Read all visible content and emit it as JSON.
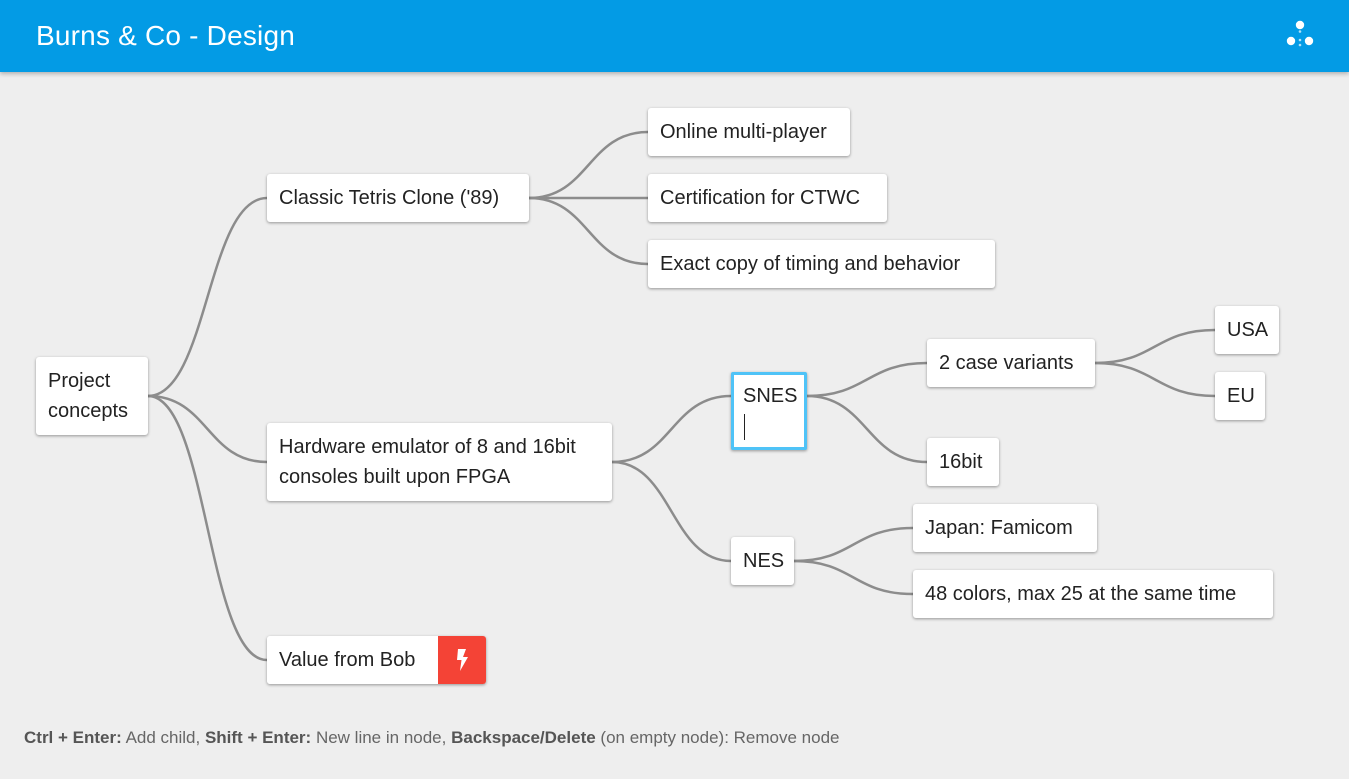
{
  "app": {
    "title": "Burns & Co - Design",
    "accent_color": "#039be5",
    "share_icon": "share-nodes-icon"
  },
  "mindmap": {
    "root": "Project\nconcepts",
    "branches": {
      "tetris": {
        "label": "Classic Tetris Clone ('89)",
        "children": [
          "Online multi-player",
          "Certification for CTWC",
          "Exact copy of timing and behavior"
        ]
      },
      "hardware": {
        "label": "Hardware emulator of 8 and 16bit\nconsoles built upon FPGA",
        "snes": {
          "label": "SNES",
          "editing": true,
          "case_variants": {
            "label": "2 case variants",
            "children": [
              "USA",
              "EU"
            ]
          },
          "bits": "16bit"
        },
        "nes": {
          "label": "NES",
          "children": [
            "Japan: Famicom",
            "48 colors, max 25 at the same time"
          ]
        }
      },
      "bob": {
        "label": "Value from Bob",
        "action_icon": "bolt-icon",
        "action_color": "#f44336"
      }
    }
  },
  "hints": {
    "add_child_key": "Ctrl + Enter:",
    "add_child_text": " Add child, ",
    "new_line_key": "Shift + Enter:",
    "new_line_text": " New line in node, ",
    "remove_key": "Backspace/Delete",
    "remove_text": " (on empty node): Remove node"
  }
}
